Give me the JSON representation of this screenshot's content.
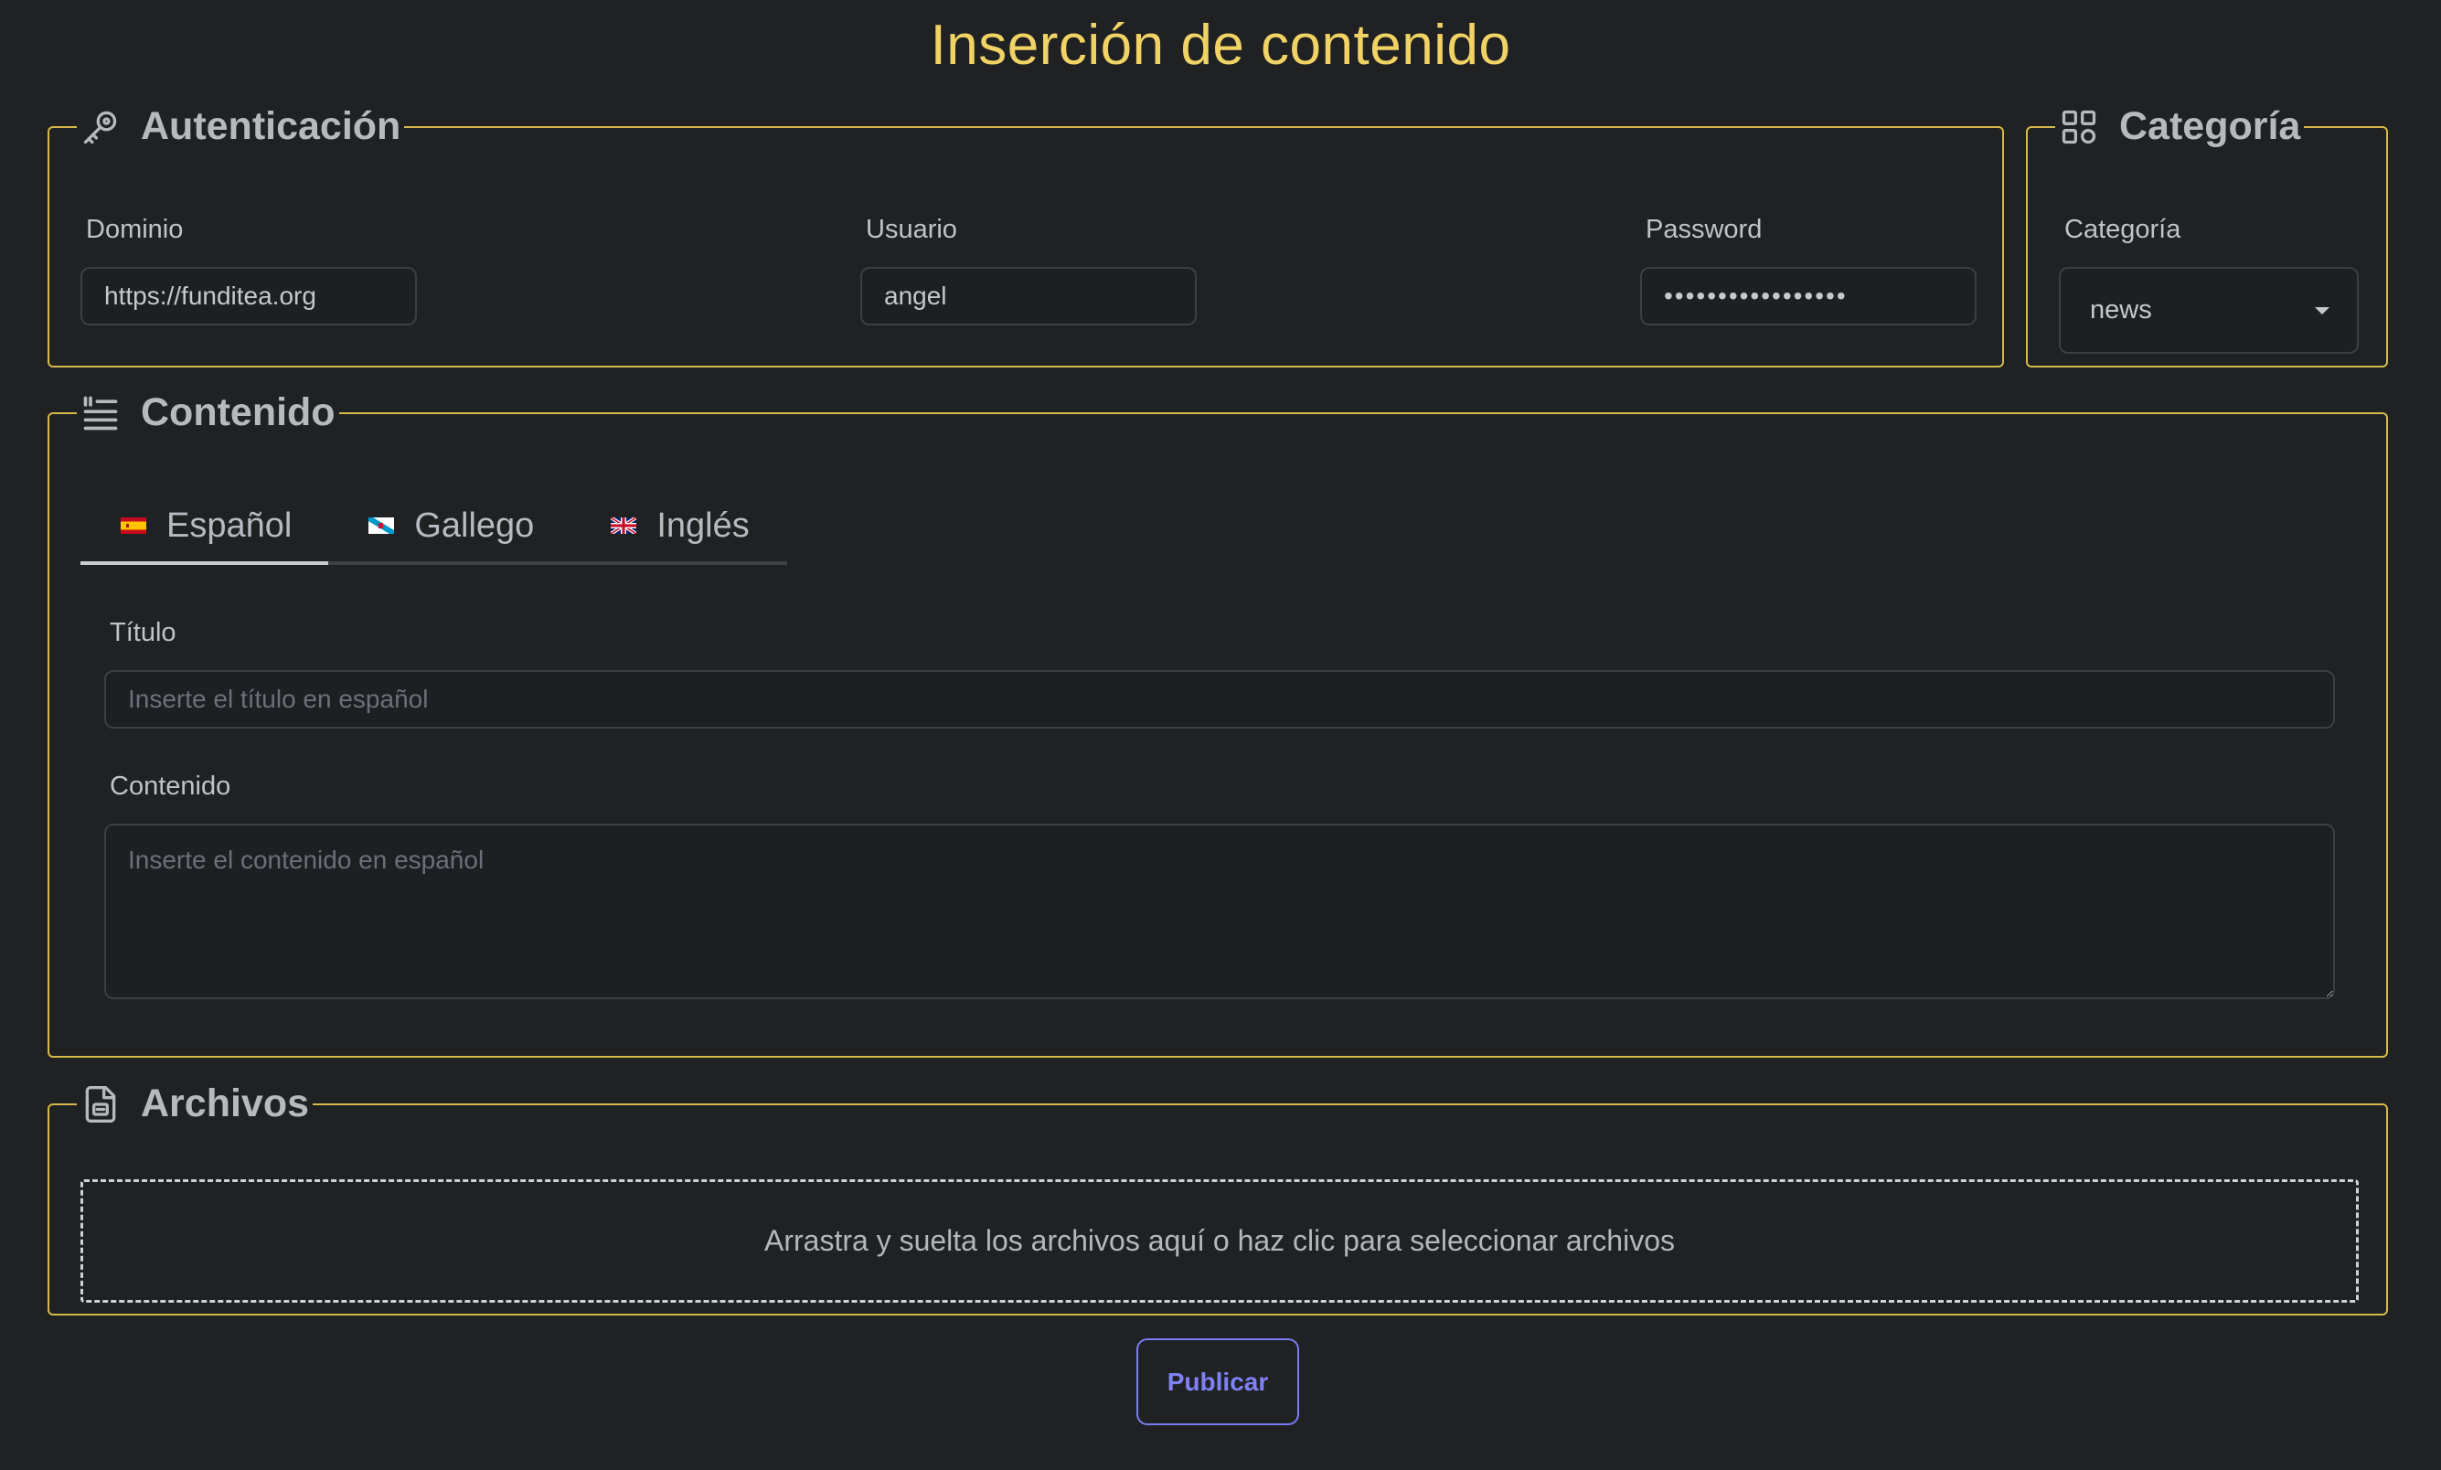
{
  "page": {
    "title": "Inserción de contenido"
  },
  "auth": {
    "legend": "Autenticación",
    "icon": "key-icon",
    "domain": {
      "label": "Dominio",
      "value": "https://funditea.org"
    },
    "user": {
      "label": "Usuario",
      "value": "angel"
    },
    "password": {
      "label": "Password",
      "value": "abcdefghijklmnopq"
    }
  },
  "category": {
    "legend": "Categoría",
    "icon": "grid-icon",
    "label": "Categoría",
    "selected": "news"
  },
  "content": {
    "legend": "Contenido",
    "icon": "text-quote-icon",
    "tabs": [
      {
        "label": "Español",
        "flag": "spain-flag-icon",
        "active": true
      },
      {
        "label": "Gallego",
        "flag": "galicia-flag-icon",
        "active": false
      },
      {
        "label": "Inglés",
        "flag": "uk-flag-icon",
        "active": false
      }
    ],
    "title_label": "Título",
    "title_placeholder": "Inserte el título en español",
    "body_label": "Contenido",
    "body_placeholder": "Inserte el contenido en español"
  },
  "files": {
    "legend": "Archivos",
    "icon": "file-icon",
    "dropzone_text": "Arrastra y suelta los archivos aquí o haz clic para seleccionar archivos"
  },
  "actions": {
    "publish_label": "Publicar"
  },
  "colors": {
    "background": "#1f2123",
    "accent_title": "#f1d365",
    "fieldset_border": "#d6b94a",
    "publish": "#7b7df2"
  }
}
